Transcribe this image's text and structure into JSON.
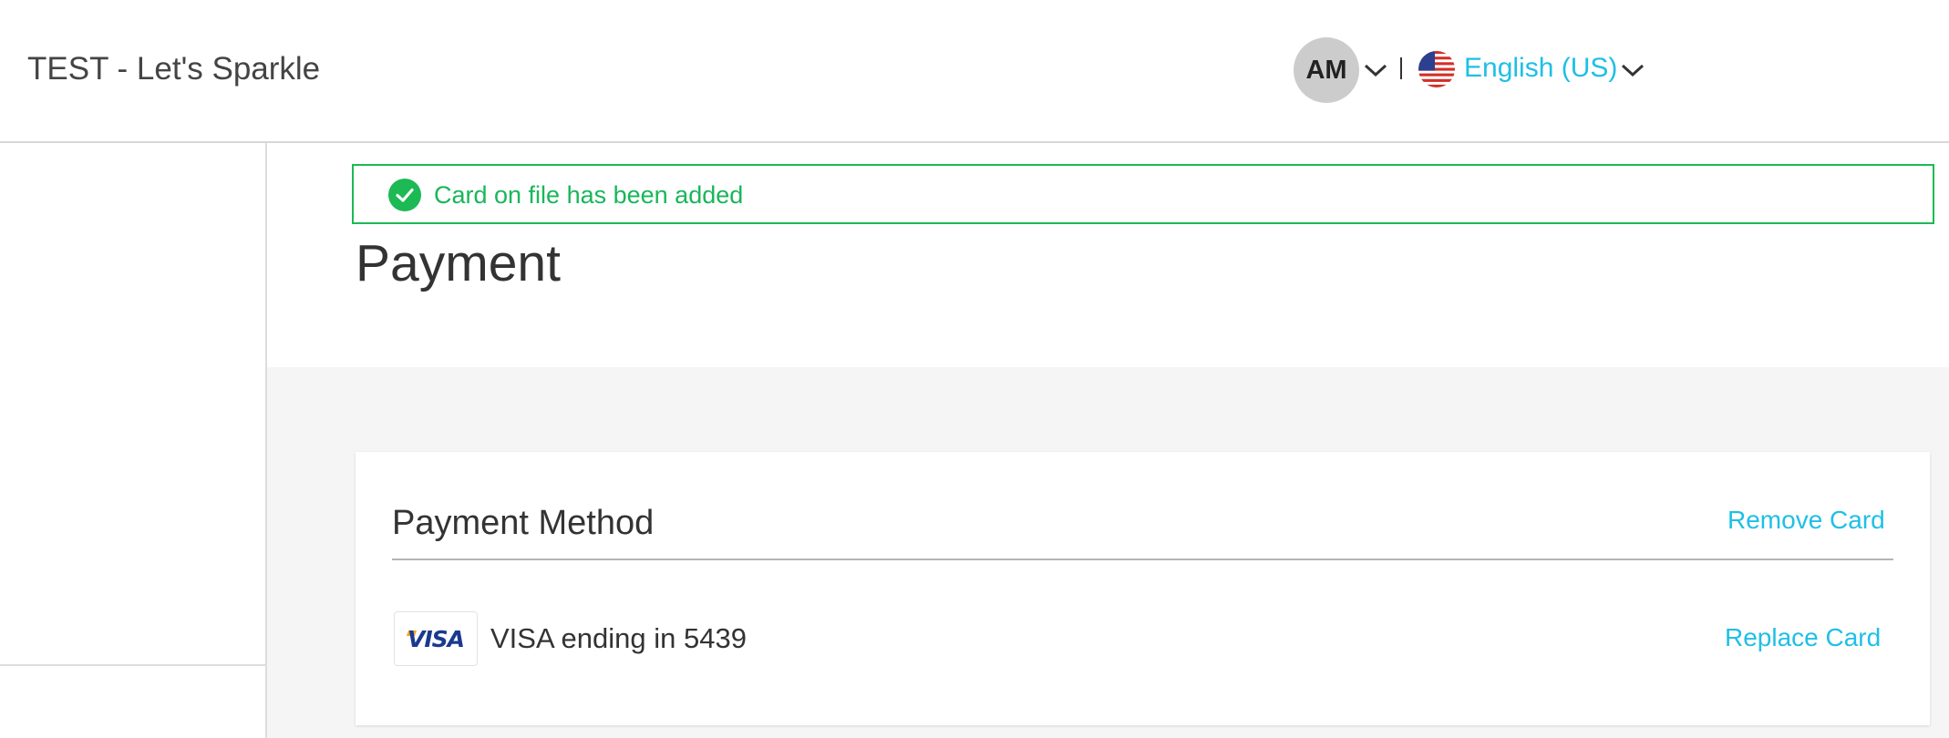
{
  "header": {
    "app_title": "TEST - Let's Sparkle",
    "avatar_initials": "AM",
    "language_label": "English (US)"
  },
  "alert": {
    "message": "Card on file has been added",
    "icon": "check-circle-icon",
    "color": "#19b65a"
  },
  "page": {
    "title": "Payment"
  },
  "payment_method": {
    "title": "Payment Method",
    "remove_label": "Remove Card",
    "replace_label": "Replace Card",
    "card_brand_logo": "VISA",
    "card_description": "VISA ending in 5439"
  },
  "colors": {
    "link": "#1fbfe6",
    "success": "#1db954",
    "gray_bg": "#f5f5f5"
  }
}
